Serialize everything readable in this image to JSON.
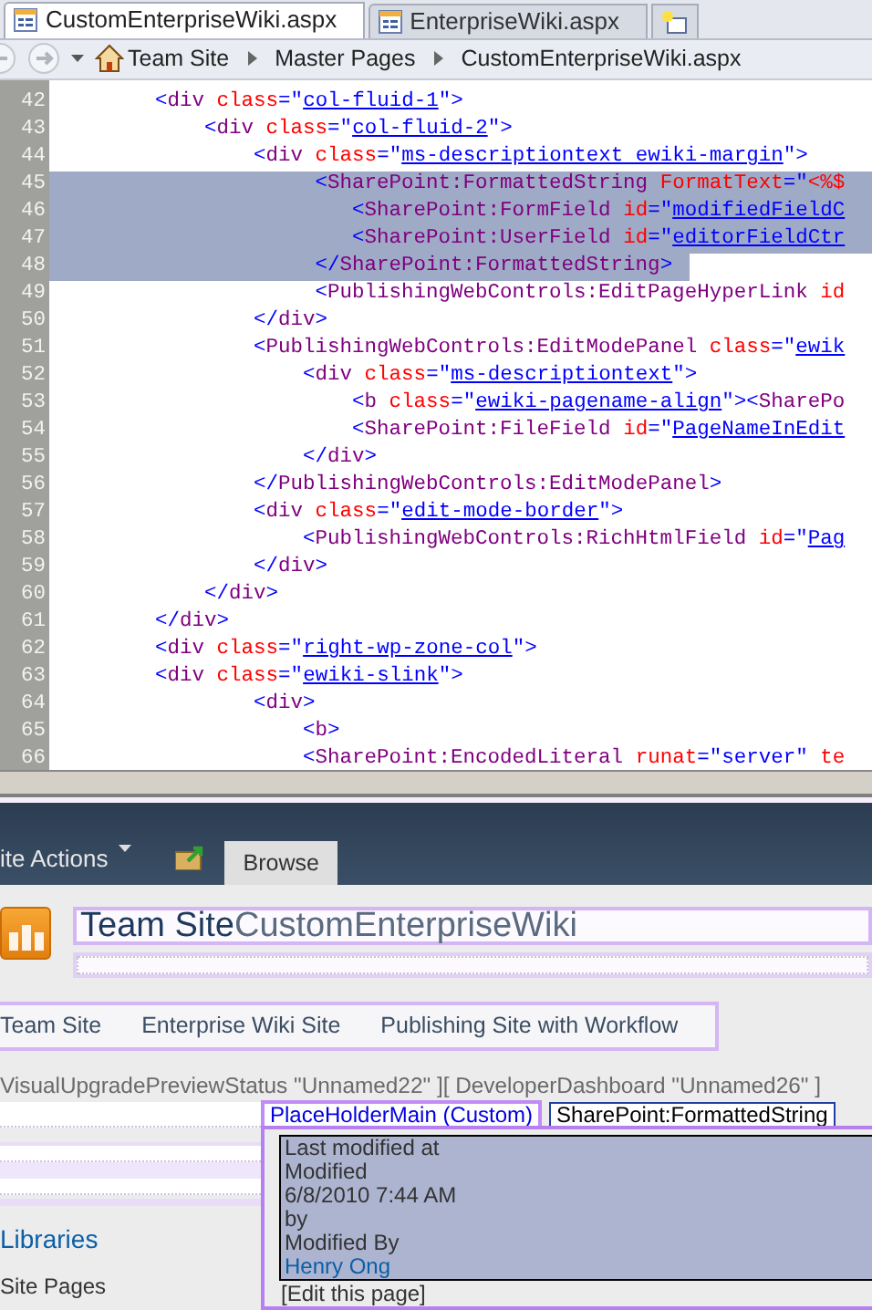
{
  "tabs": [
    {
      "label": "CustomEnterpriseWiki.aspx",
      "selected": true
    },
    {
      "label": "EnterpriseWiki.aspx",
      "selected": false
    }
  ],
  "breadcrumb": [
    "Team Site",
    "Master Pages",
    "CustomEnterpriseWiki.aspx"
  ],
  "code_lines": [
    {
      "number": "42",
      "selected": false,
      "tokens": [
        {
          "kind": "p",
          "text": "        <"
        },
        {
          "kind": "t",
          "text": "div"
        },
        {
          "kind": "a",
          "text": " class"
        },
        {
          "kind": "p",
          "text": "=\""
        },
        {
          "kind": "u",
          "text": "col-fluid-1"
        },
        {
          "kind": "p",
          "text": "\">"
        }
      ]
    },
    {
      "number": "43",
      "selected": false,
      "tokens": [
        {
          "kind": "p",
          "text": "            <"
        },
        {
          "kind": "t",
          "text": "div"
        },
        {
          "kind": "a",
          "text": " class"
        },
        {
          "kind": "p",
          "text": "=\""
        },
        {
          "kind": "u",
          "text": "col-fluid-2"
        },
        {
          "kind": "p",
          "text": "\">"
        }
      ]
    },
    {
      "number": "44",
      "selected": false,
      "tokens": [
        {
          "kind": "p",
          "text": "                <"
        },
        {
          "kind": "t",
          "text": "div"
        },
        {
          "kind": "a",
          "text": " class"
        },
        {
          "kind": "p",
          "text": "=\""
        },
        {
          "kind": "u",
          "text": "ms-descriptiontext ewiki-margin"
        },
        {
          "kind": "p",
          "text": "\">"
        }
      ]
    },
    {
      "number": "45",
      "selected": true,
      "tokens": [
        {
          "kind": "p",
          "text": "                     <"
        },
        {
          "kind": "t",
          "text": "SharePoint:FormattedString"
        },
        {
          "kind": "a",
          "text": " FormatText"
        },
        {
          "kind": "p",
          "text": "=\""
        },
        {
          "kind": "a",
          "text": "<%$"
        }
      ]
    },
    {
      "number": "46",
      "selected": true,
      "tokens": [
        {
          "kind": "p",
          "text": "                        <"
        },
        {
          "kind": "t",
          "text": "SharePoint:FormField"
        },
        {
          "kind": "a",
          "text": " id"
        },
        {
          "kind": "p",
          "text": "=\""
        },
        {
          "kind": "u",
          "text": "modifiedFieldC"
        }
      ]
    },
    {
      "number": "47",
      "selected": true,
      "tokens": [
        {
          "kind": "p",
          "text": "                        <"
        },
        {
          "kind": "t",
          "text": "SharePoint:UserField"
        },
        {
          "kind": "a",
          "text": " id"
        },
        {
          "kind": "p",
          "text": "=\""
        },
        {
          "kind": "u",
          "text": "editorFieldCtr"
        }
      ]
    },
    {
      "number": "48",
      "selected": true,
      "tokens": [
        {
          "kind": "p",
          "text": "                     </"
        },
        {
          "kind": "t",
          "text": "SharePoint:FormattedString"
        },
        {
          "kind": "p",
          "text": ">"
        }
      ]
    },
    {
      "number": "49",
      "selected": false,
      "tokens": [
        {
          "kind": "p",
          "text": "                     <"
        },
        {
          "kind": "t",
          "text": "PublishingWebControls:EditPageHyperLink"
        },
        {
          "kind": "a",
          "text": " id"
        }
      ]
    },
    {
      "number": "50",
      "selected": false,
      "tokens": [
        {
          "kind": "p",
          "text": "                </"
        },
        {
          "kind": "t",
          "text": "div"
        },
        {
          "kind": "p",
          "text": ">"
        }
      ]
    },
    {
      "number": "51",
      "selected": false,
      "tokens": [
        {
          "kind": "p",
          "text": "                <"
        },
        {
          "kind": "t",
          "text": "PublishingWebControls:EditModePanel"
        },
        {
          "kind": "a",
          "text": " class"
        },
        {
          "kind": "p",
          "text": "=\""
        },
        {
          "kind": "u",
          "text": "ewik"
        }
      ]
    },
    {
      "number": "52",
      "selected": false,
      "tokens": [
        {
          "kind": "p",
          "text": "                    <"
        },
        {
          "kind": "t",
          "text": "div"
        },
        {
          "kind": "a",
          "text": " class"
        },
        {
          "kind": "p",
          "text": "=\""
        },
        {
          "kind": "u",
          "text": "ms-descriptiontext"
        },
        {
          "kind": "p",
          "text": "\">"
        }
      ]
    },
    {
      "number": "53",
      "selected": false,
      "tokens": [
        {
          "kind": "p",
          "text": "                        <"
        },
        {
          "kind": "t",
          "text": "b"
        },
        {
          "kind": "a",
          "text": " class"
        },
        {
          "kind": "p",
          "text": "=\""
        },
        {
          "kind": "u",
          "text": "ewiki-pagename-align"
        },
        {
          "kind": "p",
          "text": "\"><"
        },
        {
          "kind": "t",
          "text": "SharePo"
        }
      ]
    },
    {
      "number": "54",
      "selected": false,
      "tokens": [
        {
          "kind": "p",
          "text": "                        <"
        },
        {
          "kind": "t",
          "text": "SharePoint:FileField"
        },
        {
          "kind": "a",
          "text": " id"
        },
        {
          "kind": "p",
          "text": "=\""
        },
        {
          "kind": "u",
          "text": "PageNameInEdit"
        }
      ]
    },
    {
      "number": "55",
      "selected": false,
      "tokens": [
        {
          "kind": "p",
          "text": "                    </"
        },
        {
          "kind": "t",
          "text": "div"
        },
        {
          "kind": "p",
          "text": ">"
        }
      ]
    },
    {
      "number": "56",
      "selected": false,
      "tokens": [
        {
          "kind": "p",
          "text": "                </"
        },
        {
          "kind": "t",
          "text": "PublishingWebControls:EditModePanel"
        },
        {
          "kind": "p",
          "text": ">"
        }
      ]
    },
    {
      "number": "57",
      "selected": false,
      "tokens": [
        {
          "kind": "p",
          "text": "                <"
        },
        {
          "kind": "t",
          "text": "div"
        },
        {
          "kind": "a",
          "text": " class"
        },
        {
          "kind": "p",
          "text": "=\""
        },
        {
          "kind": "u",
          "text": "edit-mode-border"
        },
        {
          "kind": "p",
          "text": "\">"
        }
      ]
    },
    {
      "number": "58",
      "selected": false,
      "tokens": [
        {
          "kind": "p",
          "text": "                    <"
        },
        {
          "kind": "t",
          "text": "PublishingWebControls:RichHtmlField"
        },
        {
          "kind": "a",
          "text": " id"
        },
        {
          "kind": "p",
          "text": "=\""
        },
        {
          "kind": "u",
          "text": "Pag"
        }
      ]
    },
    {
      "number": "59",
      "selected": false,
      "tokens": [
        {
          "kind": "p",
          "text": "                </"
        },
        {
          "kind": "t",
          "text": "div"
        },
        {
          "kind": "p",
          "text": ">"
        }
      ]
    },
    {
      "number": "60",
      "selected": false,
      "tokens": [
        {
          "kind": "p",
          "text": "            </"
        },
        {
          "kind": "t",
          "text": "div"
        },
        {
          "kind": "p",
          "text": ">"
        }
      ]
    },
    {
      "number": "61",
      "selected": false,
      "tokens": [
        {
          "kind": "p",
          "text": "        </"
        },
        {
          "kind": "t",
          "text": "div"
        },
        {
          "kind": "p",
          "text": ">"
        }
      ]
    },
    {
      "number": "62",
      "selected": false,
      "tokens": [
        {
          "kind": "p",
          "text": "        <"
        },
        {
          "kind": "t",
          "text": "div"
        },
        {
          "kind": "a",
          "text": " class"
        },
        {
          "kind": "p",
          "text": "=\""
        },
        {
          "kind": "u",
          "text": "right-wp-zone-col"
        },
        {
          "kind": "p",
          "text": "\">"
        }
      ]
    },
    {
      "number": "63",
      "selected": false,
      "tokens": [
        {
          "kind": "p",
          "text": "        <"
        },
        {
          "kind": "t",
          "text": "div"
        },
        {
          "kind": "a",
          "text": " class"
        },
        {
          "kind": "p",
          "text": "=\""
        },
        {
          "kind": "u",
          "text": "ewiki-slink"
        },
        {
          "kind": "p",
          "text": "\">"
        }
      ]
    },
    {
      "number": "64",
      "selected": false,
      "tokens": [
        {
          "kind": "p",
          "text": "                <"
        },
        {
          "kind": "t",
          "text": "div"
        },
        {
          "kind": "p",
          "text": ">"
        }
      ]
    },
    {
      "number": "65",
      "selected": false,
      "tokens": [
        {
          "kind": "p",
          "text": "                    <"
        },
        {
          "kind": "t",
          "text": "b"
        },
        {
          "kind": "p",
          "text": ">"
        }
      ]
    },
    {
      "number": "66",
      "selected": false,
      "tokens": [
        {
          "kind": "p",
          "text": "                    <"
        },
        {
          "kind": "t",
          "text": "SharePoint:EncodedLiteral"
        },
        {
          "kind": "a",
          "text": " runat"
        },
        {
          "kind": "p",
          "text": "=\"server\""
        },
        {
          "kind": "a",
          "text": " te"
        }
      ]
    }
  ],
  "ribbon": {
    "site_actions": "ite Actions",
    "tabs": [
      {
        "label": "Browse",
        "selected": true
      }
    ]
  },
  "site": {
    "title": "Team Site",
    "page": "CustomEnterpriseWiki"
  },
  "top_nav": [
    "Team Site",
    "Enterprise Wiki Site",
    "Publishing Site with Workflow"
  ],
  "controls_line": "VisualUpgradePreviewStatus \"Unnamed22\" ][ DeveloperDashboard \"Unnamed26\" ]",
  "quick_launch": [
    "Libraries",
    "Site Pages"
  ],
  "design_tags": [
    "PlaceHolderMain (Custom)",
    "SharePoint:FormattedString"
  ],
  "formatted_string": [
    {
      "text": "Last modified at",
      "kind": "plain"
    },
    {
      "text": "Modified",
      "kind": "plain"
    },
    {
      "text": "6/8/2010 7:44 AM",
      "kind": "plain"
    },
    {
      "text": "by",
      "kind": "plain"
    },
    {
      "text": "Modified By",
      "kind": "plain"
    },
    {
      "text": "Henry Ong",
      "kind": "link"
    }
  ],
  "edit_link": "[Edit this page]"
}
